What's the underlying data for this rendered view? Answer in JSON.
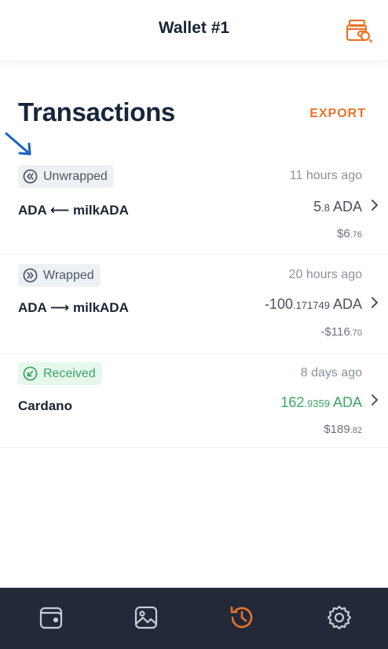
{
  "header": {
    "title": "Wallet #1",
    "wallet_switch_icon": "wallet-cards-icon"
  },
  "page": {
    "title": "Transactions",
    "export_label": "EXPORT"
  },
  "transactions": [
    {
      "badge": "Unwrapped",
      "badge_icon": "double-chevron-left-circle-icon",
      "time": "11 hours ago",
      "name": "ADA ⟵ milkADA",
      "amount_int": "5",
      "amount_dec": ".8",
      "amount_unit": " ADA",
      "fiat_int": "$6",
      "fiat_dec": ".76"
    },
    {
      "badge": "Wrapped",
      "badge_icon": "double-chevron-right-circle-icon",
      "time": "20 hours ago",
      "name": "ADA ⟶ milkADA",
      "amount_int": "-100",
      "amount_dec": ".171749",
      "amount_unit": " ADA",
      "fiat_int": "-$116",
      "fiat_dec": ".70"
    },
    {
      "badge": "Received",
      "badge_icon": "arrow-down-left-circle-icon",
      "time": "8 days ago",
      "name": "Cardano",
      "amount_int": "162",
      "amount_dec": ".9359",
      "amount_unit": " ADA",
      "fiat_int": "$189",
      "fiat_dec": ".82"
    }
  ],
  "nav": {
    "items": [
      "wallet-icon",
      "image-icon",
      "history-icon",
      "gear-icon"
    ],
    "active": "history-icon"
  },
  "colors": {
    "accent": "#e8742a",
    "positive": "#3aa661",
    "nav_bg": "#222a3a",
    "annotation": "#1565c0"
  }
}
